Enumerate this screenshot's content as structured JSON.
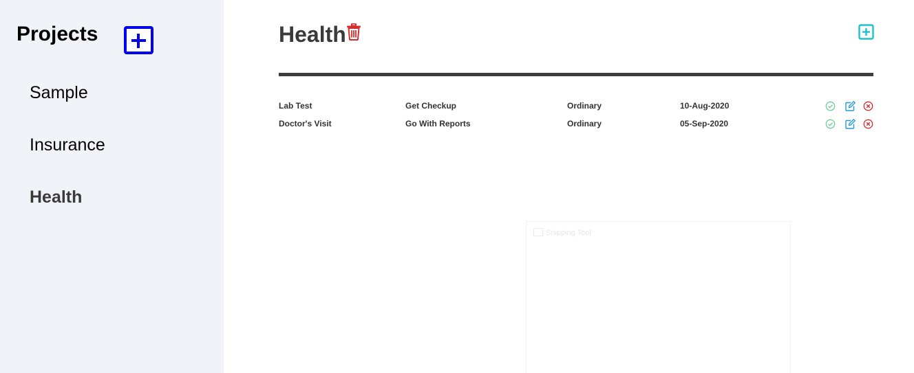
{
  "sidebar": {
    "title": "Projects",
    "add_icon": "plus-square-icon",
    "items": [
      {
        "label": "Sample",
        "active": false
      },
      {
        "label": "Insurance",
        "active": false
      },
      {
        "label": "Health",
        "active": true
      }
    ]
  },
  "main": {
    "title": "Health",
    "delete_icon": "trash-icon",
    "add_task_icon": "plus-square-icon",
    "tasks": [
      {
        "name": "Lab Test",
        "description": "Get Checkup",
        "priority": "Ordinary",
        "date": "10-Aug-2020"
      },
      {
        "name": "Doctor's Visit",
        "description": "Go With Reports",
        "priority": "Ordinary",
        "date": "05-Sep-2020"
      }
    ],
    "row_actions": [
      "check-circle-icon",
      "edit-icon",
      "x-circle-icon"
    ]
  },
  "overlay": {
    "label": "Snipping Tool"
  },
  "colors": {
    "sidebar_bg": "#f0f3f7",
    "add_project": "#0000ee",
    "delete": "#d32f2f",
    "add_task": "#1fbfcf",
    "done": "#6fcf97",
    "edit": "#1e9bd7",
    "remove": "#d32f2f"
  }
}
